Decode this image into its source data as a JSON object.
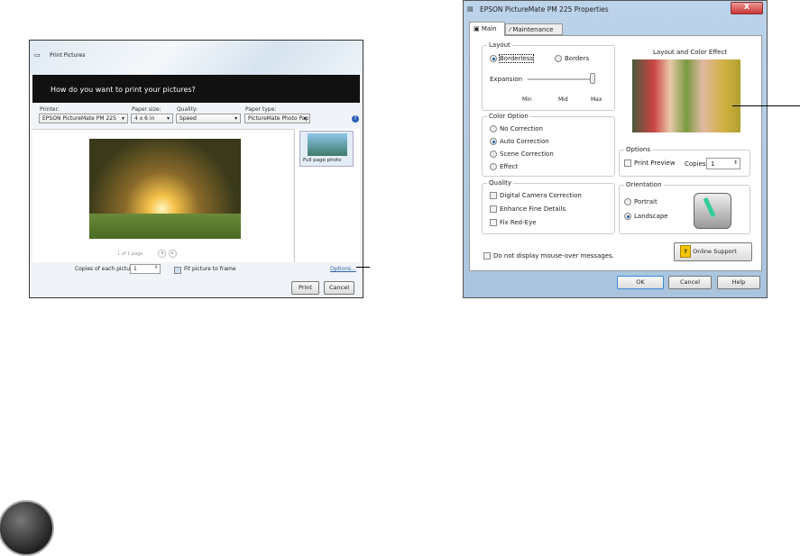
{
  "print_pictures": {
    "title": "Print Pictures",
    "header": "How do you want to print your pictures?",
    "printer": {
      "label": "Printer:",
      "value": "EPSON PictureMate PM 225"
    },
    "paper_size": {
      "label": "Paper size:",
      "value": "4 x 6 in"
    },
    "quality": {
      "label": "Quality:",
      "value": "Speed"
    },
    "paper_type": {
      "label": "Paper type:",
      "value": "PictureMate Photo Pap"
    },
    "thumbnail_label": "Full page photo",
    "page_indicator": "1 of 1 page",
    "copies_label": "Copies of each picture:",
    "copies_value": "1",
    "fit_label": "Fit picture to frame",
    "options_link": "Options...",
    "print_button": "Print",
    "cancel_button": "Cancel"
  },
  "properties": {
    "title": "EPSON PictureMate PM 225 Properties",
    "close": "X",
    "tabs": [
      "Main",
      "Maintenance"
    ],
    "layout": {
      "title": "Layout",
      "borderless": "Borderless",
      "borders": "Borders",
      "expansion": "Expansion",
      "min": "Min",
      "mid": "Mid",
      "max": "Max",
      "expansion_level": 1.0
    },
    "preview_title": "Layout and Color Effect",
    "color_option": {
      "title": "Color Option",
      "items": [
        "No Correction",
        "Auto Correction",
        "Scene Correction",
        "Effect"
      ],
      "selected": 1
    },
    "options": {
      "title": "Options",
      "print_preview": "Print Preview",
      "copies_label": "Copies",
      "copies_value": "1"
    },
    "quality": {
      "title": "Quality",
      "items": [
        "Digital Camera Correction",
        "Enhance Fine Details",
        "Fix Red-Eye"
      ]
    },
    "orientation": {
      "title": "Orientation",
      "portrait": "Portrait",
      "landscape": "Landscape"
    },
    "online_support": "Online Support",
    "mouseover": "Do not display mouse-over messages.",
    "ok": "OK",
    "cancel": "Cancel",
    "help": "Help"
  }
}
